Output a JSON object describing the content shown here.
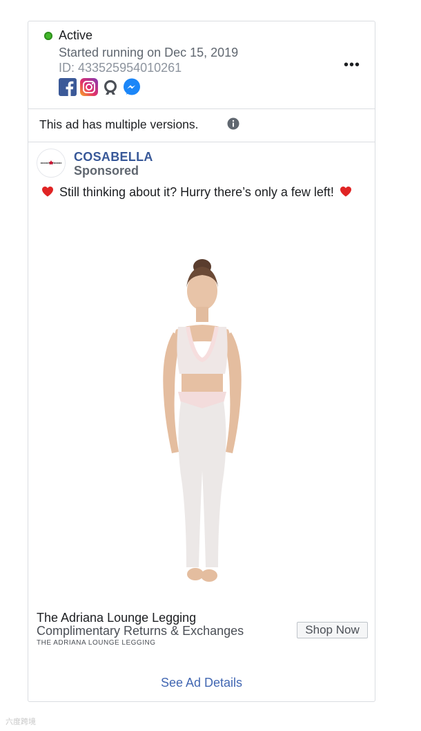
{
  "status": {
    "label": "Active",
    "started": "Started running on Dec 15, 2019",
    "id": "ID: 433525954010261",
    "platforms": [
      "facebook-icon",
      "instagram-icon",
      "audience-network-icon",
      "messenger-icon"
    ],
    "more_label": "•••"
  },
  "versions": {
    "text": "This ad has multiple versions."
  },
  "advertiser": {
    "name": "COSABELLA",
    "sponsored": "Sponsored",
    "logo_text": "COSABELLA"
  },
  "ad": {
    "body_main": "Still thinking about it? Hurry there’s only a few",
    "body_end": "left!"
  },
  "cta": {
    "title": "The Adriana Lounge Legging",
    "description": "Complimentary Returns & Exchanges",
    "domain": "THE ADRIANA LOUNGE LEGGING",
    "button": "Shop Now"
  },
  "footer": {
    "details_link": "See Ad Details"
  },
  "watermark": "六度跨境",
  "colors": {
    "active": "#42b72a",
    "link": "#4267b2",
    "advertiser": "#385898"
  }
}
